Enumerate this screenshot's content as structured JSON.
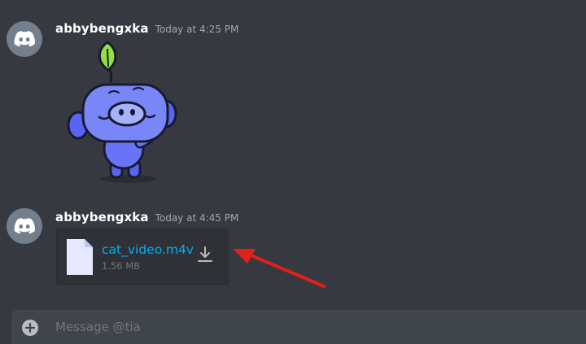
{
  "messages": [
    {
      "username": "abbybengxka",
      "timestamp": "Today at 4:25 PM",
      "sticker": "wumpus-with-leaf-waving"
    },
    {
      "username": "abbybengxka",
      "timestamp": "Today at 4:45 PM",
      "attachment": {
        "file_name": "cat_video.m4v",
        "file_size": "1.56 MB",
        "icon": "file-icon",
        "action_icon": "download-icon"
      }
    }
  ],
  "composer": {
    "placeholder": "Message @tia",
    "attach_icon": "plus-circle-icon"
  },
  "annotation": {
    "icon": "red-arrow-icon",
    "color": "#e0201c"
  },
  "colors": {
    "background": "#36393f",
    "link": "#00aff4",
    "attachment_bg": "#2f3136",
    "composer_bg": "#40444b"
  }
}
